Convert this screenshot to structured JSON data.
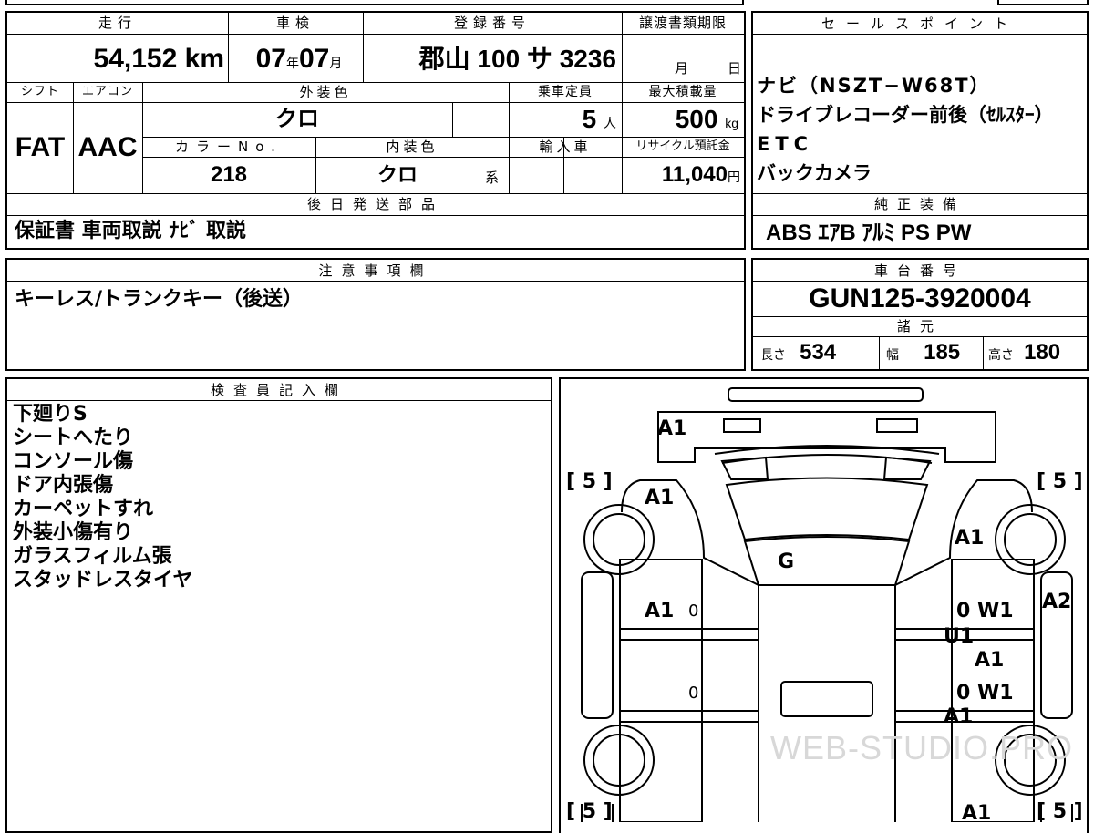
{
  "vehicle": {
    "mileage_label": "走行",
    "mileage": "54,152",
    "mileage_unit": "km",
    "inspection_label": "車検",
    "inspection_year": "07",
    "inspection_year_unit": "年",
    "inspection_month": "07",
    "inspection_month_unit": "月",
    "registration_label": "登録番号",
    "registration": "郡山 100 サ 3236",
    "transfer_label": "譲渡書類期限",
    "transfer_month_unit": "月",
    "transfer_day_unit": "日",
    "shift_label": "シフト",
    "shift": "FAT",
    "aircon_label": "エアコン",
    "aircon": "AAC",
    "exterior_color_label": "外装色",
    "exterior_color": "クロ",
    "capacity_label": "乗車定員",
    "capacity": "5",
    "capacity_unit": "人",
    "max_load_label": "最大積載量",
    "max_load": "500",
    "max_load_unit": "kg",
    "color_no_label": "カラーNo.",
    "color_no": "218",
    "interior_color_label": "内装色",
    "interior_color": "クロ",
    "interior_color_unit": "系",
    "import_label": "輸入車",
    "recycle_label": "リサイクル預託金",
    "recycle": "11,040",
    "recycle_unit": "円"
  },
  "sales_points": {
    "title": "セールスポイント",
    "lines": [
      "ナビ（NSZT−W68T）",
      "ドライブレコーダー前後（ｾﾙｽﾀｰ）",
      "ETC",
      "バックカメラ"
    ]
  },
  "later_parts": {
    "title": "後日発送部品",
    "text": "保証書 車両取説 ﾅﾋﾞ 取説"
  },
  "factory_equipment": {
    "title": "純正装備",
    "text": "ABS ｴｱB ｱﾙﾐ PS PW"
  },
  "notes": {
    "title": "注意事項欄",
    "text": "キーレス/トランクキー（後送）"
  },
  "chassis": {
    "title": "車台番号",
    "number": "GUN125-3920004"
  },
  "specs": {
    "title": "諸元",
    "length_label": "長さ",
    "length": "534",
    "width_label": "幅",
    "width": "185",
    "height_label": "高さ",
    "height": "180"
  },
  "inspector": {
    "title": "検査員記入欄",
    "lines": [
      "下廻りS",
      "シートへたり",
      "コンソール傷",
      "ドア内張傷",
      "カーペットすれ",
      "外装小傷有り",
      "ガラスフィルム張",
      "スタッドレスタイヤ"
    ]
  },
  "diagram": {
    "tires": [
      "[ 5 ]",
      "[ 5 ]",
      "[ 5 ]",
      "[ 5 ]"
    ],
    "marks": [
      "A1",
      "A1",
      "A1",
      "G",
      "A1",
      "0",
      "0 W1",
      "A2",
      "U1",
      "A1",
      "0",
      "0 W1",
      "A1",
      "A1"
    ],
    "watermark": "WEB-STUDIO.PRO"
  }
}
